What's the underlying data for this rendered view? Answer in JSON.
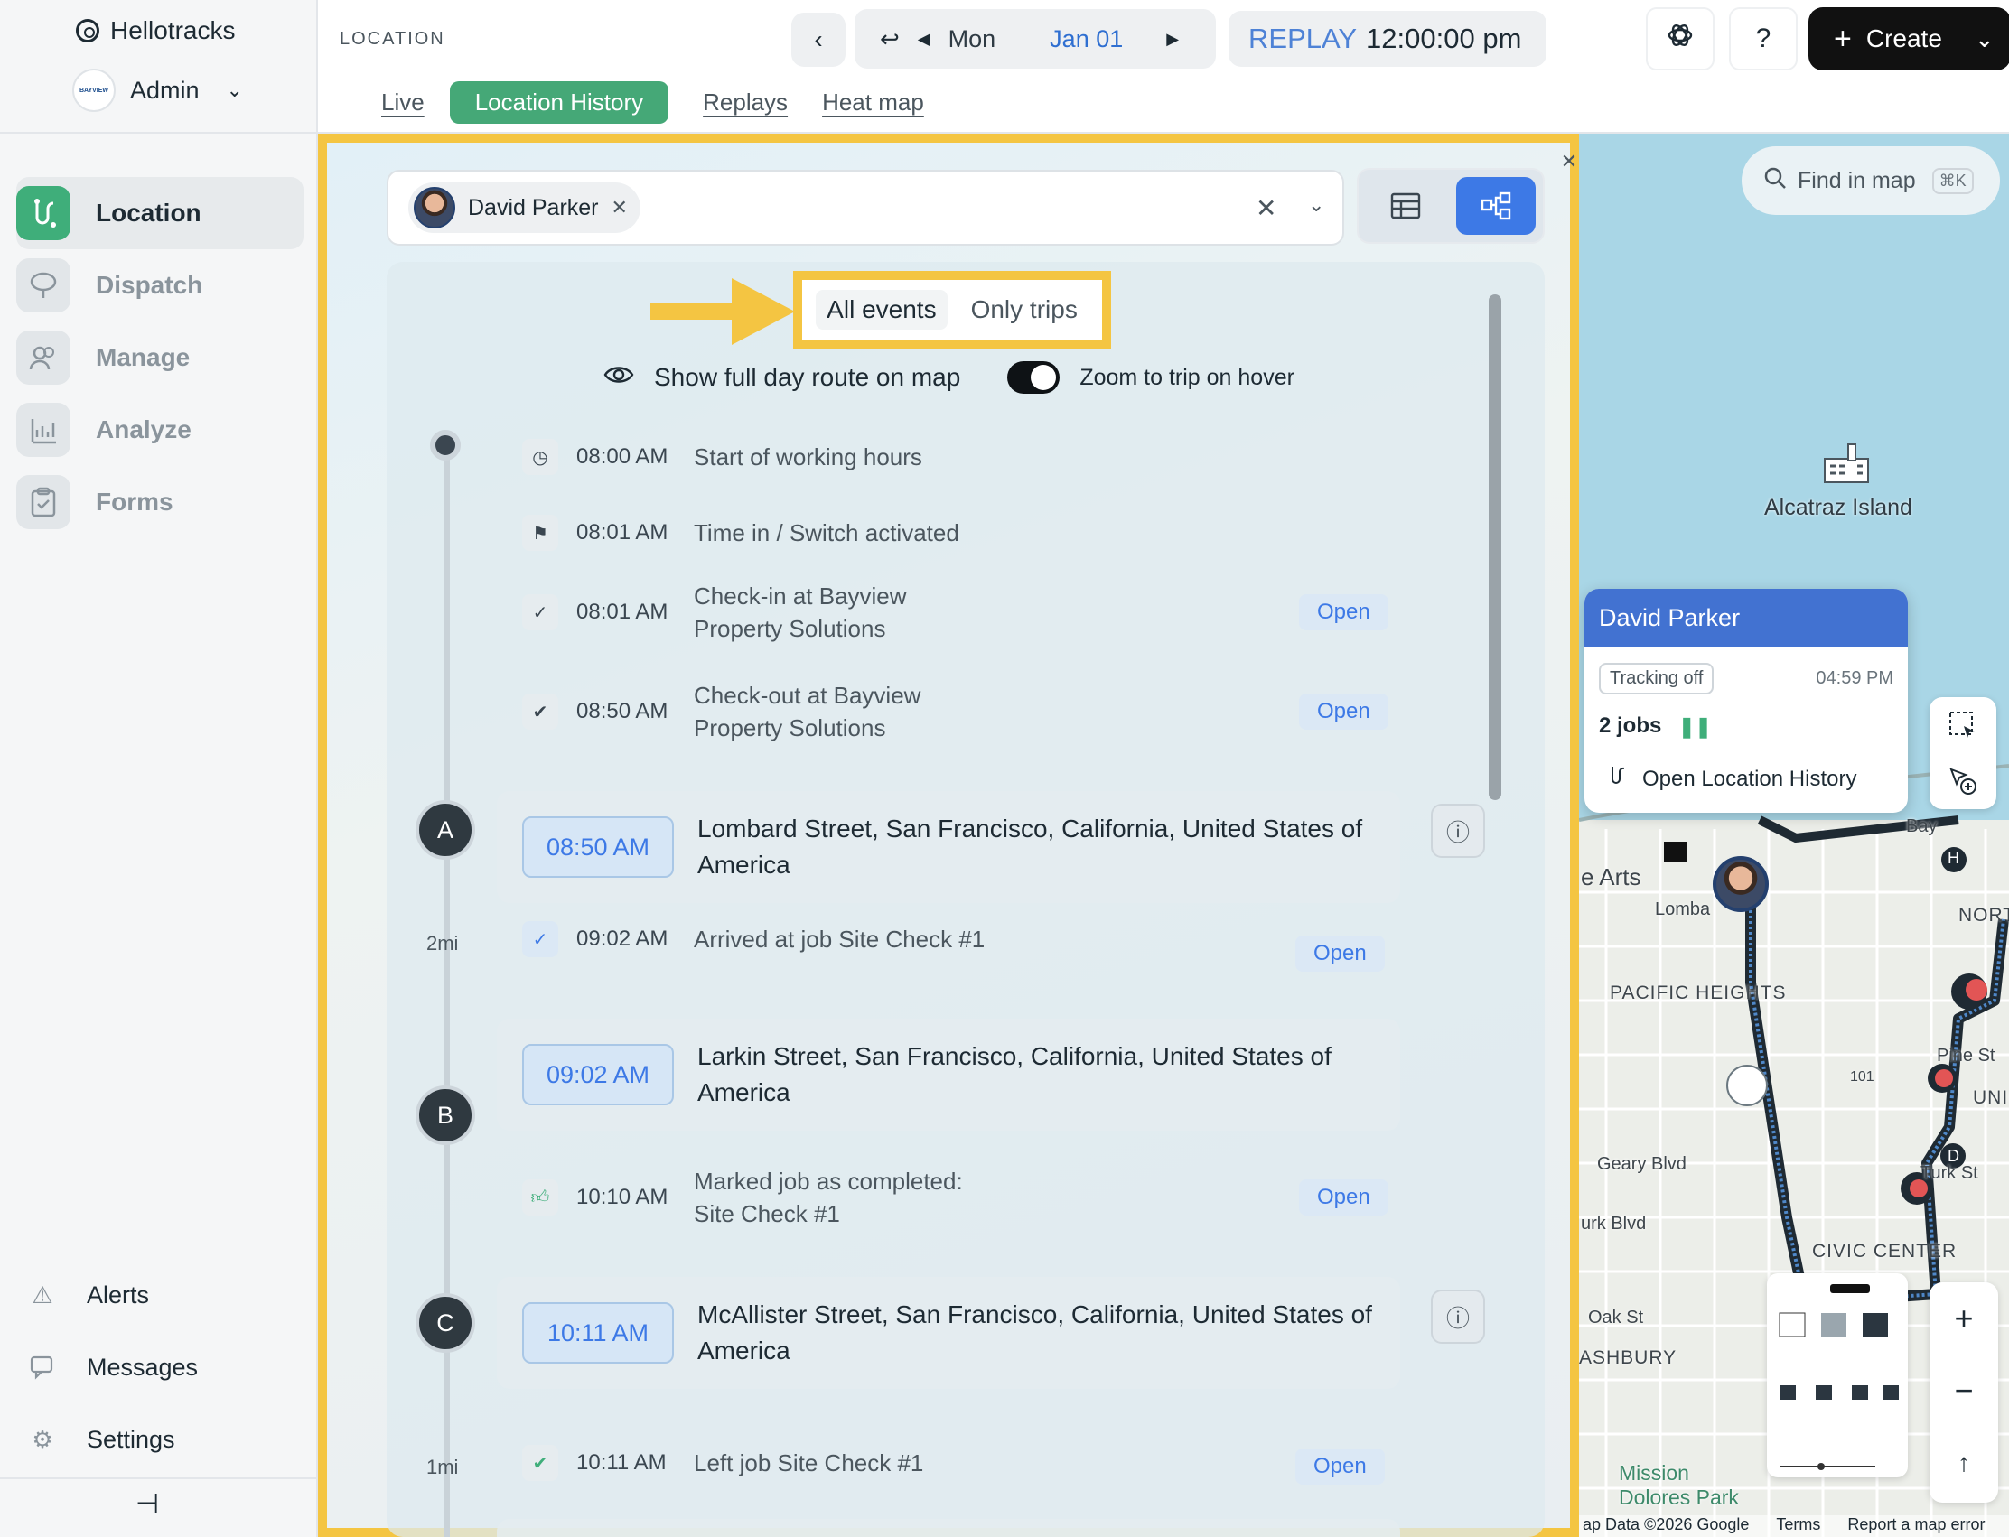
{
  "brand": {
    "name": "Hellotracks"
  },
  "account": {
    "name": "Admin",
    "logo_text": "BAYVIEW"
  },
  "sidebar": {
    "items": [
      {
        "label": "Location",
        "icon": "route-icon",
        "active": true
      },
      {
        "label": "Dispatch",
        "icon": "dispatch-icon",
        "active": false
      },
      {
        "label": "Manage",
        "icon": "users-icon",
        "active": false
      },
      {
        "label": "Analyze",
        "icon": "chart-icon",
        "active": false
      },
      {
        "label": "Forms",
        "icon": "clipboard-icon",
        "active": false
      }
    ],
    "bottom": [
      {
        "label": "Alerts",
        "icon": "warning-icon"
      },
      {
        "label": "Messages",
        "icon": "chat-icon"
      },
      {
        "label": "Settings",
        "icon": "gear-icon"
      }
    ]
  },
  "header": {
    "crumb": "LOCATION",
    "day": "Mon",
    "date": "Jan 01",
    "replay_label": "REPLAY",
    "replay_time": "12:00:00 pm",
    "help": "?",
    "create": "Create"
  },
  "tabs": [
    {
      "label": "Live"
    },
    {
      "label": "Location History",
      "active": true
    },
    {
      "label": "Replays"
    },
    {
      "label": "Heat map"
    }
  ],
  "panel": {
    "selected_user": "David Parker",
    "filter": {
      "all": "All events",
      "trips": "Only trips",
      "selected": "All events"
    },
    "show_route": "Show full day route on map",
    "zoom_hover": "Zoom to trip on hover",
    "zoom_hover_on": true,
    "events": [
      {
        "time": "08:00 AM",
        "text": "Start of working hours",
        "icon": "clock-icon"
      },
      {
        "time": "08:01 AM",
        "text": "Time in / Switch activated",
        "icon": "flag-icon"
      },
      {
        "time": "08:01 AM",
        "text": "Check-in at Bayview Property Solutions",
        "icon": "check-icon",
        "action": "Open"
      },
      {
        "time": "08:50 AM",
        "text": "Check-out at Bayview Property Solutions",
        "icon": "double-check-icon",
        "action": "Open"
      },
      {
        "time": "09:02 AM",
        "text": "Arrived at job Site Check #1",
        "icon": "check-icon",
        "action": "Open"
      },
      {
        "time": "10:10 AM",
        "text": "Marked job as completed: Site Check #1",
        "icon": "thumbs-up-icon",
        "action": "Open"
      },
      {
        "time": "10:11 AM",
        "text": "Left job Site Check #1",
        "icon": "double-check-icon",
        "action": "Open"
      }
    ],
    "stops": [
      {
        "marker": "A",
        "time": "08:50 AM",
        "address": "Lombard Street, San Francisco, California, United States of America"
      },
      {
        "marker": "B",
        "time": "09:02 AM",
        "address": "Larkin Street, San Francisco, California, United States of America"
      },
      {
        "marker": "C",
        "time": "10:11 AM",
        "address": "McAllister Street, San Francisco, California, United States of America"
      }
    ],
    "distances": [
      "2mi",
      "1mi"
    ]
  },
  "map": {
    "search_placeholder": "Find in map",
    "shortcut": "⌘K",
    "landmark": "Alcatraz Island",
    "labels": [
      "e Arts",
      "Lomba",
      "PACIFIC HEIGHTS",
      "NORTH",
      "UNIC",
      "Pine St",
      "Geary Blvd",
      "urk Blvd",
      "Turk St",
      "CIVIC CENTER",
      "Oak St",
      "ASHBURY",
      "Mission Dolores Park",
      "Bay",
      "101",
      "H",
      "D"
    ],
    "popup": {
      "name": "David Parker",
      "status": "Tracking off",
      "time": "04:59 PM",
      "jobs": "2 jobs",
      "link": "Open Location History"
    },
    "attribution": [
      "ap Data ©2026 Google",
      "Terms",
      "Report a map error"
    ],
    "colors": {
      "route": "#1f2a33",
      "popup_header": "#4272d1"
    }
  }
}
